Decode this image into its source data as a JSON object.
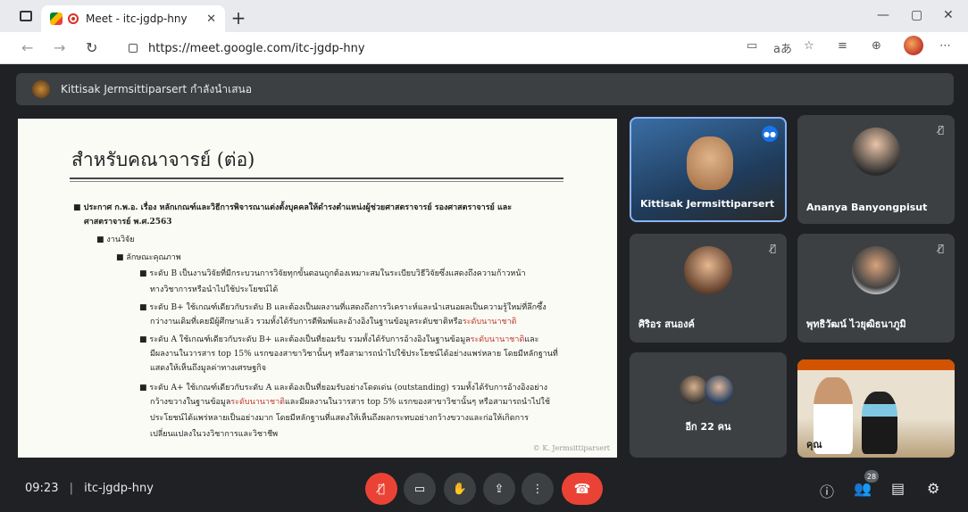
{
  "browser": {
    "tab_title": "Meet - itc-jgdp-hny",
    "url": "https://meet.google.com/itc-jgdp-hny",
    "nav_back": "←",
    "nav_forward": "→",
    "nav_reload": "↻",
    "new_tab": "+",
    "tab_close": "✕",
    "win_min": "—",
    "win_max": "▢",
    "win_close": "✕",
    "toolbar_icons": [
      "▭",
      "aあ",
      "☆",
      "≡",
      "⊕",
      "⋯"
    ]
  },
  "presenter": {
    "text": "Kittisak Jermsittiparsert กำลังนำเสนอ"
  },
  "slide": {
    "title": "สำหรับคณาจารย์ (ต่อ)",
    "line1": "■ ประกาศ ก.พ.อ. เรื่อง หลักเกณฑ์และวิธีการพิจารณาแต่งตั้งบุคคลให้ดำรงตำแหน่งผู้ช่วยศาสตราจารย์ รองศาสตราจารย์ และ",
    "line2": "ศาสตราจารย์ พ.ศ.2563",
    "line3": "■ งานวิจัย",
    "line4": "■ ลักษณะคุณภาพ",
    "b1a": "■ ระดับ B เป็นงานวิจัยที่มีกระบวนการวิจัยทุกขั้นตอนถูกต้องเหมาะสมในระเบียบวิธีวิจัยซึ่งแสดงถึงความก้าวหน้า",
    "b1b": "ทางวิชาการหรือนำไปใช้ประโยชน์ได้",
    "b2a": "■ ระดับ B+ ใช้เกณฑ์เดียวกับระดับ B และต้องเป็นผลงานที่แสดงถึงการวิเคราะห์และนำเสนอผลเป็นความรู้ใหม่ที่ลึกซึ้ง",
    "b2b": "กว่างานเดิมที่เคยมีผู้ศึกษาแล้ว รวมทั้งได้รับการตีพิมพ์และอ้างอิงในฐานข้อมูลระดับชาติหรือ",
    "b2b_red": "ระดับนานาชาติ",
    "b3a_pre": "■ ระดับ A ใช้เกณฑ์เดียวกับระดับ B+ และต้องเป็นที่ยอมรับ รวมทั้งได้รับการอ้างอิงในฐานข้อมูล",
    "b3a_red": "ระดับนานาชาติ",
    "b3a_post": "และ",
    "b3b": "มีผลงานในวารสาร top 15% แรกของสาขาวิชานั้นๆ หรือสามารถนำไปใช้ประโยชน์ได้อย่างแพร่หลาย โดยมีหลักฐานที่",
    "b3c": "แสดงให้เห็นถึงมูลค่าทางเศรษฐกิจ",
    "b4a": "■ ระดับ A+ ใช้เกณฑ์เดียวกับระดับ A และต้องเป็นที่ยอมรับอย่างโดดเด่น (outstanding) รวมทั้งได้รับการอ้างอิงอย่าง",
    "b4b_pre": "กว้างขวางในฐานข้อมูล",
    "b4b_red": "ระดับนานาชาติ",
    "b4b_post": "และมีผลงานในวารสาร top 5% แรกของสาขาวิชานั้นๆ หรือสามารถนำไปใช้",
    "b4c": "ประโยชน์ได้แพร่หลายเป็นอย่างมาก โดยมีหลักฐานที่แสดงให้เห็นถึงผลกระทบอย่างกว้างขวางและก่อให้เกิดการ",
    "b4d": "เปลี่ยนแปลงในวงวิชาการและวิชาชีพ",
    "credit": "© K. Jermsittiparsert"
  },
  "participants": [
    {
      "name": "Kittisak Jermsittiparsert"
    },
    {
      "name": "Ananya Banyongpisut"
    },
    {
      "name": "ศิริอร สนองค์"
    },
    {
      "name": "พุทธิวัฒน์ ไวยุฒิธนาภูมิ"
    },
    {
      "name": "อีก 22 คน"
    },
    {
      "name": "คุณ"
    }
  ],
  "bottom": {
    "time": "09:23",
    "meeting_code": "itc-jgdp-hny",
    "people_count": "28"
  }
}
